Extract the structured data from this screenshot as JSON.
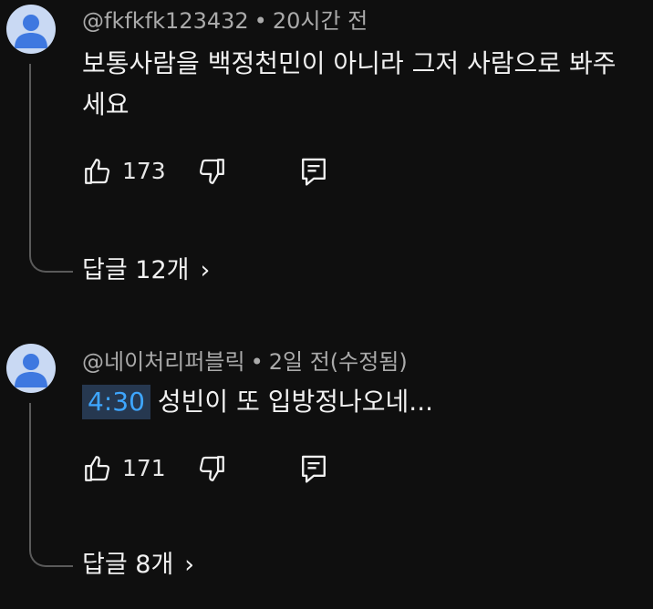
{
  "comments": [
    {
      "username": "@fkfkfk123432",
      "separator": "•",
      "time": "20시간 전",
      "timestamp_link": "",
      "text": "보통사람을 백정천민이 아니라 그저 사람으로 봐주세요",
      "likes": "173",
      "replies_label": "답글 12개",
      "chevron": "›"
    },
    {
      "username": "@네이처리퍼블릭",
      "separator": "•",
      "time": "2일 전(수정됨)",
      "timestamp_link": "4:30",
      "text": "성빈이 또 입방정나오네...",
      "likes": "171",
      "replies_label": "답글 8개",
      "chevron": "›"
    }
  ],
  "icons": {
    "avatar": "default-avatar-icon",
    "like": "thumbs-up-icon",
    "dislike": "thumbs-down-icon",
    "reply": "reply-comment-icon"
  },
  "colors": {
    "background": "#0f0f0f",
    "avatar": "#c9d9f3",
    "avatar_figure": "#3e78e0",
    "timestamp_link": "#3ea6ff"
  }
}
